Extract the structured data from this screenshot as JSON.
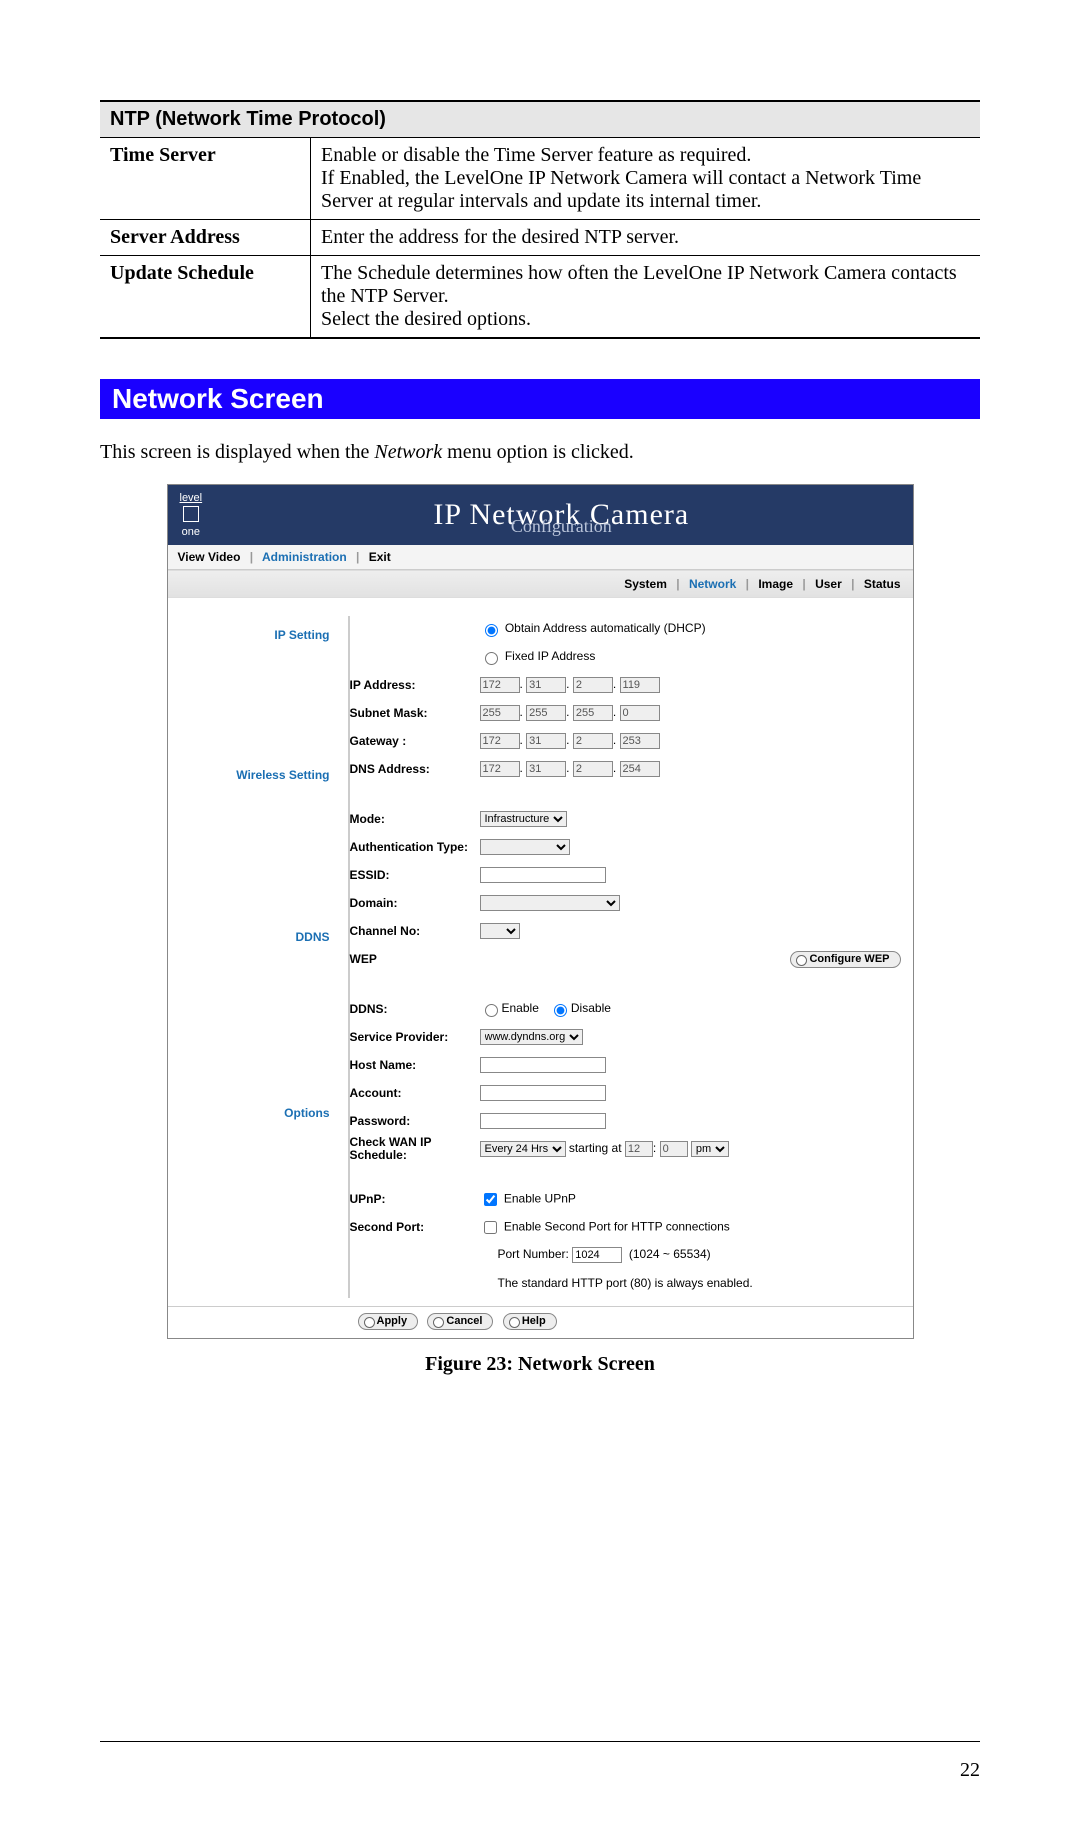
{
  "ntp": {
    "header": "NTP (Network Time Protocol)",
    "rows": [
      {
        "label": "Time Server",
        "desc": "Enable or disable the Time Server feature as required.\nIf Enabled, the LevelOne IP Network Camera will contact a Network Time Server at regular intervals and update its internal timer."
      },
      {
        "label": "Server Address",
        "desc": "Enter the address for the desired NTP server."
      },
      {
        "label": "Update Schedule",
        "desc": "The Schedule determines how often the LevelOne IP Network Camera contacts the NTP Server.\nSelect the desired options."
      }
    ]
  },
  "section_title": "Network Screen",
  "intro_pre": "This screen is displayed when the ",
  "intro_em": "Network",
  "intro_post": " menu option is clicked.",
  "shot": {
    "logo_top": "level",
    "logo_bottom": "one",
    "brand_main": "IP Network Camera",
    "brand_sub": "Configuration",
    "nav1": {
      "view": "View Video",
      "admin": "Administration",
      "exit": "Exit"
    },
    "nav2": {
      "system": "System",
      "network": "Network",
      "image": "Image",
      "user": "User",
      "status": "Status"
    },
    "ip": {
      "title": "IP Setting",
      "dhcp": "Obtain Address automatically (DHCP)",
      "fixed": "Fixed IP Address",
      "ipaddr_lbl": "IP Address:",
      "ipaddr": [
        "172",
        "31",
        "2",
        "119"
      ],
      "subnet_lbl": "Subnet Mask:",
      "subnet": [
        "255",
        "255",
        "255",
        "0"
      ],
      "gateway_lbl": "Gateway :",
      "gateway": [
        "172",
        "31",
        "2",
        "253"
      ],
      "dns_lbl": "DNS Address:",
      "dns": [
        "172",
        "31",
        "2",
        "254"
      ]
    },
    "wifi": {
      "title": "Wireless Setting",
      "mode_lbl": "Mode:",
      "mode_val": "Infrastructure",
      "auth_lbl": "Authentication Type:",
      "essid_lbl": "ESSID:",
      "domain_lbl": "Domain:",
      "chan_lbl": "Channel No:",
      "wep_lbl": "WEP",
      "configure_btn": "Configure WEP"
    },
    "ddns": {
      "title": "DDNS",
      "ddns_lbl": "DDNS:",
      "enable": "Enable",
      "disable": "Disable",
      "provider_lbl": "Service Provider:",
      "provider_val": "www.dyndns.org",
      "host_lbl": "Host Name:",
      "account_lbl": "Account:",
      "password_lbl": "Password:",
      "schedule_lbl": "Check WAN IP Schedule:",
      "schedule_val": "Every 24 Hrs",
      "starting": "starting at",
      "sh": "12",
      "sm": "0",
      "ampm": "pm"
    },
    "options": {
      "title": "Options",
      "upnp_lbl": "UPnP:",
      "upnp_enable": "Enable UPnP",
      "second_lbl": "Second Port:",
      "second_enable": "Enable Second Port for HTTP connections",
      "portnum_lbl": "Port Number:",
      "portnum_val": "1024",
      "portrange": "(1024 ~ 65534)",
      "portnote": "The standard HTTP port (80) is always enabled."
    },
    "footer": {
      "apply": "Apply",
      "cancel": "Cancel",
      "help": "Help"
    }
  },
  "figcap": "Figure 23: Network Screen",
  "pagenum": "22"
}
